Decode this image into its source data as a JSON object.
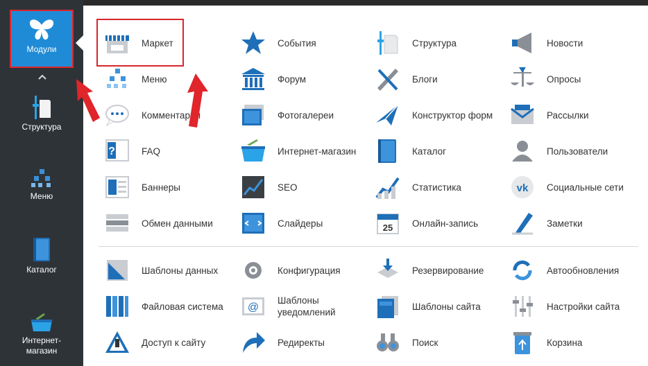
{
  "sidebar": {
    "items": [
      {
        "key": "modules",
        "label": "Модули",
        "icon": "butterfly-icon"
      },
      {
        "key": "structure",
        "label": "Структура",
        "icon": "structure-icon"
      },
      {
        "key": "menu",
        "label": "Меню",
        "icon": "menu-tree-icon"
      },
      {
        "key": "catalog",
        "label": "Каталог",
        "icon": "catalog-book-icon"
      },
      {
        "key": "shop",
        "label": "Интернет-магазин",
        "label_line1": "Интернет-",
        "label_line2": "магазин",
        "icon": "basket-icon"
      }
    ],
    "collapse_icon": "chevron-up-icon"
  },
  "modules": {
    "rows": [
      [
        {
          "label": "Маркет",
          "icon": "market-stall-icon"
        },
        {
          "label": "События",
          "icon": "star-icon"
        },
        {
          "label": "Структура",
          "icon": "structure-icon"
        },
        {
          "label": "Новости",
          "icon": "megaphone-icon"
        }
      ],
      [
        {
          "label": "Меню",
          "icon": "menu-tree-icon"
        },
        {
          "label": "Форум",
          "icon": "forum-building-icon"
        },
        {
          "label": "Блоги",
          "icon": "pen-icon"
        },
        {
          "label": "Опросы",
          "icon": "scales-icon"
        }
      ],
      [
        {
          "label": "Комментарии",
          "icon": "speech-bubble-icon"
        },
        {
          "label": "Фотогалереи",
          "icon": "photo-gallery-icon"
        },
        {
          "label": "Конструктор форм",
          "icon": "paper-plane-icon"
        },
        {
          "label": "Рассылки",
          "icon": "mail-icon"
        }
      ],
      [
        {
          "label": "FAQ",
          "icon": "faq-book-icon"
        },
        {
          "label": "Интернет-магазин",
          "icon": "basket-icon"
        },
        {
          "label": "Каталог",
          "icon": "catalog-book-icon"
        },
        {
          "label": "Пользователи",
          "icon": "user-icon"
        }
      ],
      [
        {
          "label": "Баннеры",
          "icon": "banner-icon"
        },
        {
          "label": "SEO",
          "icon": "seo-chart-icon"
        },
        {
          "label": "Статистика",
          "icon": "statistics-icon"
        },
        {
          "label": "Социальные сети",
          "icon": "vk-icon"
        }
      ],
      [
        {
          "label": "Обмен данными",
          "icon": "data-exchange-icon"
        },
        {
          "label": "Слайдеры",
          "icon": "slider-icon"
        },
        {
          "label": "Онлайн-запись",
          "icon": "calendar-icon"
        },
        {
          "label": "Заметки",
          "icon": "notes-icon"
        }
      ]
    ],
    "system_rows": [
      [
        {
          "label": "Шаблоны данных",
          "icon": "data-templates-icon"
        },
        {
          "label": "Конфигурация",
          "icon": "gear-icon"
        },
        {
          "label": "Резервирование",
          "icon": "backup-icon"
        },
        {
          "label": "Автообновления",
          "icon": "refresh-icon"
        }
      ],
      [
        {
          "label": "Файловая система",
          "icon": "folders-icon"
        },
        {
          "label": "Шаблоны уведомлений",
          "label_line1": "Шаблоны",
          "label_line2": "уведомлений",
          "icon": "notification-mail-icon"
        },
        {
          "label": "Шаблоны сайта",
          "icon": "site-templates-icon"
        },
        {
          "label": "Настройки сайта",
          "icon": "sliders-icon"
        }
      ],
      [
        {
          "label": "Доступ к сайту",
          "icon": "warning-sign-icon"
        },
        {
          "label": "Редиректы",
          "icon": "redirect-arrow-icon"
        },
        {
          "label": "Поиск",
          "icon": "binoculars-icon"
        },
        {
          "label": "Корзина",
          "icon": "recycle-bin-icon"
        }
      ]
    ]
  },
  "colors": {
    "sidebar_bg": "#2e3338",
    "active_bg": "#1f8bd7",
    "highlight_red": "#e0252b",
    "icon_blue": "#1e6fb8"
  }
}
